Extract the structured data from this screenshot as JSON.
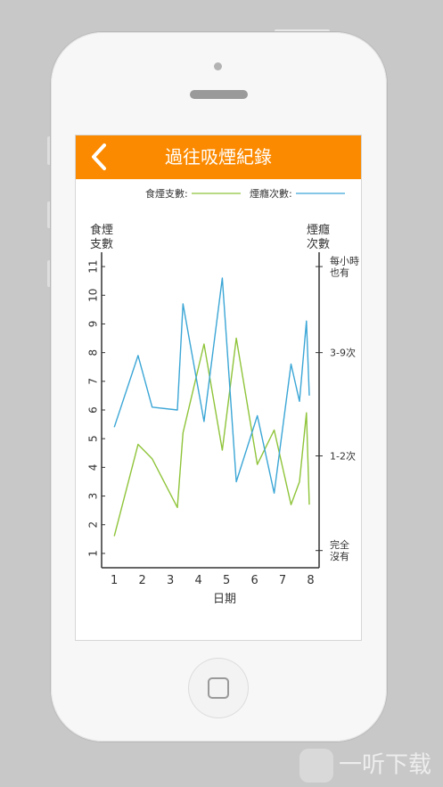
{
  "header": {
    "title": "過往吸煙紀錄",
    "back_icon": "chevron-left-icon"
  },
  "colors": {
    "accent": "#fb8a00",
    "series_a": "#8fc43a",
    "series_b": "#3ba6d6"
  },
  "watermark": "一听下载",
  "chart_data": {
    "type": "line",
    "legend": {
      "placement": "top-right"
    },
    "xlabel": "日期",
    "ylabel_left": [
      "食煙",
      "支數"
    ],
    "ylabel_right": [
      "煙癮",
      "次數"
    ],
    "x_ticks": [
      "1",
      "2",
      "3",
      "4",
      "5",
      "6",
      "7",
      "8"
    ],
    "y_ticks": [
      "1",
      "2",
      "3",
      "4",
      "5",
      "6",
      "7",
      "8",
      "9",
      "10",
      "11"
    ],
    "ylim": [
      0.5,
      11.5
    ],
    "xlim": [
      0.55,
      8.3
    ],
    "y2_ticks": [
      {
        "value": 1.1,
        "lines": [
          "完全",
          "沒有"
        ]
      },
      {
        "value": 4.4,
        "lines": [
          "1-2次"
        ]
      },
      {
        "value": 8.0,
        "lines": [
          "3-9次"
        ]
      },
      {
        "value": 11.0,
        "lines": [
          "每小時",
          "也有"
        ]
      }
    ],
    "series": [
      {
        "name": "食煙支數:",
        "axis": "left",
        "x": [
          1,
          1.85,
          2.35,
          3.25,
          3.45,
          4.2,
          4.85,
          5.35,
          6.1,
          6.7,
          7.3,
          7.6,
          7.85,
          7.95
        ],
        "y": [
          1.6,
          4.8,
          4.3,
          2.6,
          5.2,
          8.3,
          4.6,
          8.5,
          4.1,
          5.3,
          2.7,
          3.5,
          5.9,
          2.7
        ]
      },
      {
        "name": "煙癮次數:",
        "axis": "right",
        "x": [
          1,
          1.85,
          2.35,
          3.25,
          3.45,
          4.2,
          4.85,
          5.35,
          6.1,
          6.7,
          7.3,
          7.6,
          7.85,
          7.95
        ],
        "y": [
          5.4,
          7.9,
          6.1,
          6.0,
          9.7,
          5.6,
          10.6,
          3.5,
          5.8,
          3.1,
          7.6,
          6.3,
          9.1,
          6.5
        ]
      }
    ]
  }
}
